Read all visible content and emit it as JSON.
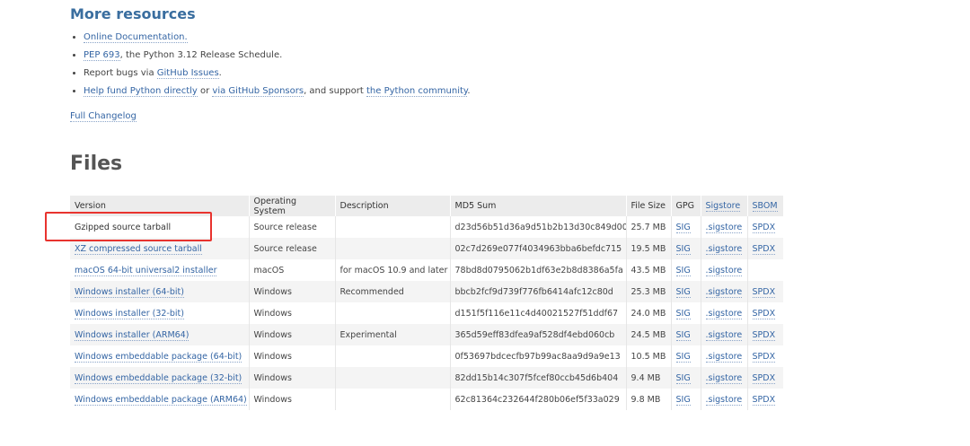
{
  "more_resources": {
    "heading": "More resources",
    "items": [
      {
        "link1": "Online Documentation.",
        "text1": "",
        "link2": "",
        "text2": "",
        "link3": "",
        "text3": ""
      },
      {
        "link1": "PEP 693",
        "text1": ", the Python 3.12 Release Schedule.",
        "link2": "",
        "text2": "",
        "link3": "",
        "text3": ""
      },
      {
        "pre": "Report bugs via ",
        "link1": "GitHub Issues",
        "text1": ".",
        "link2": "",
        "text2": "",
        "link3": "",
        "text3": ""
      },
      {
        "link1": "Help fund Python directly",
        "text1": " or ",
        "link2": "via GitHub Sponsors",
        "text2": ", and support ",
        "link3": "the Python community",
        "text3": "."
      }
    ],
    "changelog": "Full Changelog"
  },
  "files": {
    "heading": "Files",
    "columns": [
      "Version",
      "Operating System",
      "Description",
      "MD5 Sum",
      "File Size",
      "GPG",
      "Sigstore",
      "SBOM"
    ],
    "rows": [
      {
        "version": "Gzipped source tarball",
        "os": "Source release",
        "desc": "",
        "md5": "d23d56b51d36a9d51b2b13d30c849d00",
        "size": "25.7 MB",
        "gpg": "SIG",
        "sigstore": ".sigstore",
        "sbom": "SPDX"
      },
      {
        "version": "XZ compressed source tarball",
        "os": "Source release",
        "desc": "",
        "md5": "02c7d269e077f4034963bba6befdc715",
        "size": "19.5 MB",
        "gpg": "SIG",
        "sigstore": ".sigstore",
        "sbom": "SPDX"
      },
      {
        "version": "macOS 64-bit universal2 installer",
        "os": "macOS",
        "desc": "for macOS 10.9 and later",
        "md5": "78bd8d0795062b1df63e2b8d8386a5fa",
        "size": "43.5 MB",
        "gpg": "SIG",
        "sigstore": ".sigstore",
        "sbom": ""
      },
      {
        "version": "Windows installer (64-bit)",
        "os": "Windows",
        "desc": "Recommended",
        "md5": "bbcb2fcf9d739f776fb6414afc12c80d",
        "size": "25.3 MB",
        "gpg": "SIG",
        "sigstore": ".sigstore",
        "sbom": "SPDX"
      },
      {
        "version": "Windows installer (32-bit)",
        "os": "Windows",
        "desc": "",
        "md5": "d151f5f116e11c4d40021527f51ddf67",
        "size": "24.0 MB",
        "gpg": "SIG",
        "sigstore": ".sigstore",
        "sbom": "SPDX"
      },
      {
        "version": "Windows installer (ARM64)",
        "os": "Windows",
        "desc": "Experimental",
        "md5": "365d59eff83dfea9af528df4ebd060cb",
        "size": "24.5 MB",
        "gpg": "SIG",
        "sigstore": ".sigstore",
        "sbom": "SPDX"
      },
      {
        "version": "Windows embeddable package (64-bit)",
        "os": "Windows",
        "desc": "",
        "md5": "0f53697bdcecfb97b99ac8aa9d9a9e13",
        "size": "10.5 MB",
        "gpg": "SIG",
        "sigstore": ".sigstore",
        "sbom": "SPDX"
      },
      {
        "version": "Windows embeddable package (32-bit)",
        "os": "Windows",
        "desc": "",
        "md5": "82dd15b14c307f5fcef80ccb45d6b404",
        "size": "9.4 MB",
        "gpg": "SIG",
        "sigstore": ".sigstore",
        "sbom": "SPDX"
      },
      {
        "version": "Windows embeddable package (ARM64)",
        "os": "Windows",
        "desc": "",
        "md5": "62c81364c232644f280b06ef5f33a029",
        "size": "9.8 MB",
        "gpg": "SIG",
        "sigstore": ".sigstore",
        "sbom": "SPDX"
      }
    ]
  },
  "colors": {
    "link": "#3465a4",
    "heading": "#3a6e9f",
    "highlight": "#e8332e"
  }
}
